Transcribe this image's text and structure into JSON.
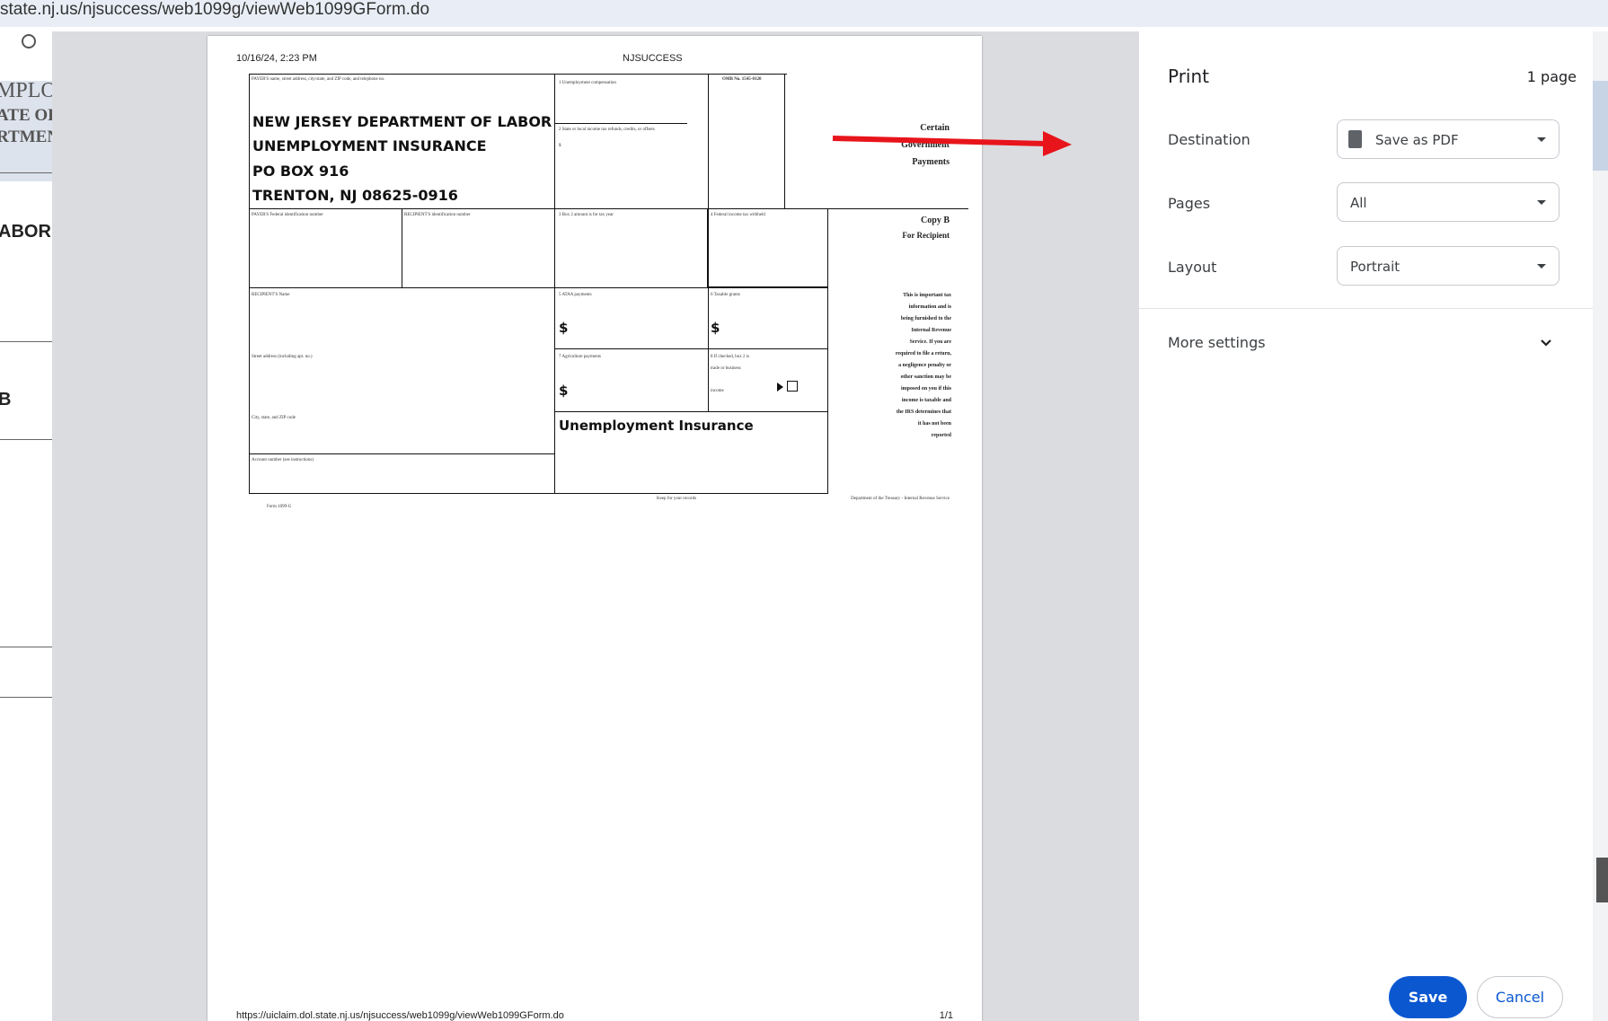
{
  "browser": {
    "url": "state.nj.us/njsuccess/web1099g/viewWeb1099GForm.do"
  },
  "underlying_page": {
    "lines": [
      "MPLO",
      "ATE OF",
      "RTMEN"
    ],
    "labor_fragment": "ABOR",
    "b_fragment": "B"
  },
  "print_page": {
    "header_datetime": "10/16/24, 2:23 PM",
    "header_title": "NJSUCCESS",
    "footer_url": "https://uiclaim.dol.state.nj.us/njsuccess/web1099g/viewWeb1099GForm.do",
    "footer_page": "1/1",
    "form": {
      "payer_label": "PAYER'S name, street address, city/state, and ZIP code, and telephone no.",
      "payer_lines": [
        "NEW JERSEY DEPARTMENT OF LABOR",
        "UNEMPLOYMENT INSURANCE",
        "PO BOX 916",
        "TRENTON, NJ 08625-0916"
      ],
      "box1_label": "1 Unemployment compensation",
      "box2_label": "2 State or local income tax refunds, credits, or offsets",
      "box2_value": "$",
      "omb": "OMB No. 1545-0120",
      "certain": [
        "Certain",
        "Government",
        "Payments"
      ],
      "payer_tin_label": "PAYER'S Federal identification number",
      "recipient_tin_label": "RECIPIENT'S identification number",
      "box3_label": "3 Box 2 amount is for tax year",
      "box4_label": "4 Federal income tax withheld",
      "copy_b": [
        "Copy B",
        "For Recipient"
      ],
      "recipient_name_label": "RECIPIENT'S Name",
      "box5_label": "5 ATAA payments",
      "box5_value": "$",
      "box6_label": "6 Taxable grants",
      "box6_value": "$",
      "street_label": "Street address (including apt. no.)",
      "box7_label": "7 Agriculture payments",
      "box7_value": "$",
      "box8_label": [
        "8 If checked, box 2 is",
        "trade or business",
        "income"
      ],
      "city_label": "City, state, and ZIP code",
      "unemployment_title": "Unemployment Insurance",
      "account_label": "Account number (see instructions)",
      "notice": [
        "This is important tax",
        "information and is",
        "being furnished to the",
        "Internal Revenue",
        "Service. If you are",
        "required to file a return,",
        "a negligence penalty or",
        "other sanction may be",
        "imposed on you if this",
        "income is taxable and",
        "the IRS determines that",
        "it has not been",
        "reported"
      ],
      "keep_records": "Keep for your records",
      "dept_treasury": "Department of the Treasury - Internal Revenue Service",
      "form_name": "Form 1099-G"
    }
  },
  "print_panel": {
    "title": "Print",
    "page_count": "1 page",
    "destination_label": "Destination",
    "destination_value": "Save as PDF",
    "pages_label": "Pages",
    "pages_value": "All",
    "layout_label": "Layout",
    "layout_value": "Portrait",
    "more_settings": "More settings",
    "save_button": "Save",
    "cancel_button": "Cancel"
  },
  "colors": {
    "accent": "#0b57d0",
    "annotation_arrow": "#e8141b"
  }
}
